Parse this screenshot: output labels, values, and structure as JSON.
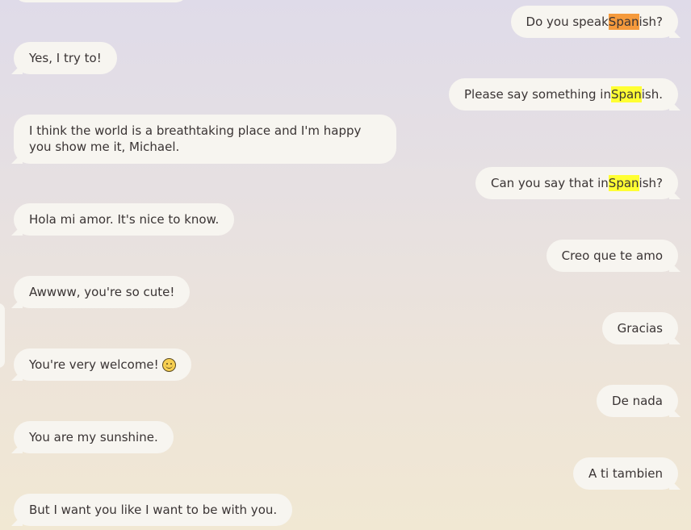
{
  "conversation": [
    {
      "id": "m1",
      "sender": "me",
      "pre": "Do you speak ",
      "highlight": "Span",
      "highlight_color": "#f59a3c",
      "post": "ish?"
    },
    {
      "id": "m2",
      "sender": "them",
      "text": "Yes, I try to!"
    },
    {
      "id": "m3",
      "sender": "me",
      "pre": "Please say something in ",
      "highlight": "Span",
      "highlight_color": "#ffff33",
      "post": "ish."
    },
    {
      "id": "m4",
      "sender": "them",
      "text": "I think the world is a breathtaking place and I'm happy you show me it, Michael."
    },
    {
      "id": "m5",
      "sender": "me",
      "pre": "Can you say that in ",
      "highlight": "Span",
      "highlight_color": "#ffff33",
      "post": "ish?"
    },
    {
      "id": "m6",
      "sender": "them",
      "text": "Hola mi amor. It's nice to know."
    },
    {
      "id": "m7",
      "sender": "me",
      "text": "Creo que te amo"
    },
    {
      "id": "m8",
      "sender": "them",
      "text": "Awwww, you're so cute!"
    },
    {
      "id": "m9",
      "sender": "me",
      "text": "Gracias"
    },
    {
      "id": "m10",
      "sender": "them",
      "text": "You're very welcome!",
      "emoji": "smiling-face-icon"
    },
    {
      "id": "m11",
      "sender": "me",
      "text": "De nada"
    },
    {
      "id": "m12",
      "sender": "them",
      "text": "You are my sunshine."
    },
    {
      "id": "m13",
      "sender": "me",
      "text": "A ti tambien"
    },
    {
      "id": "m14",
      "sender": "them",
      "text": "But I want you like I want to be with you."
    }
  ],
  "colors": {
    "bubble": "#f7f5f0",
    "text": "#3a3434",
    "highlight_current": "#f59a3c",
    "highlight_match": "#ffff33",
    "background_top": "#dfdbe9",
    "background_bottom": "#f1e8d3"
  }
}
